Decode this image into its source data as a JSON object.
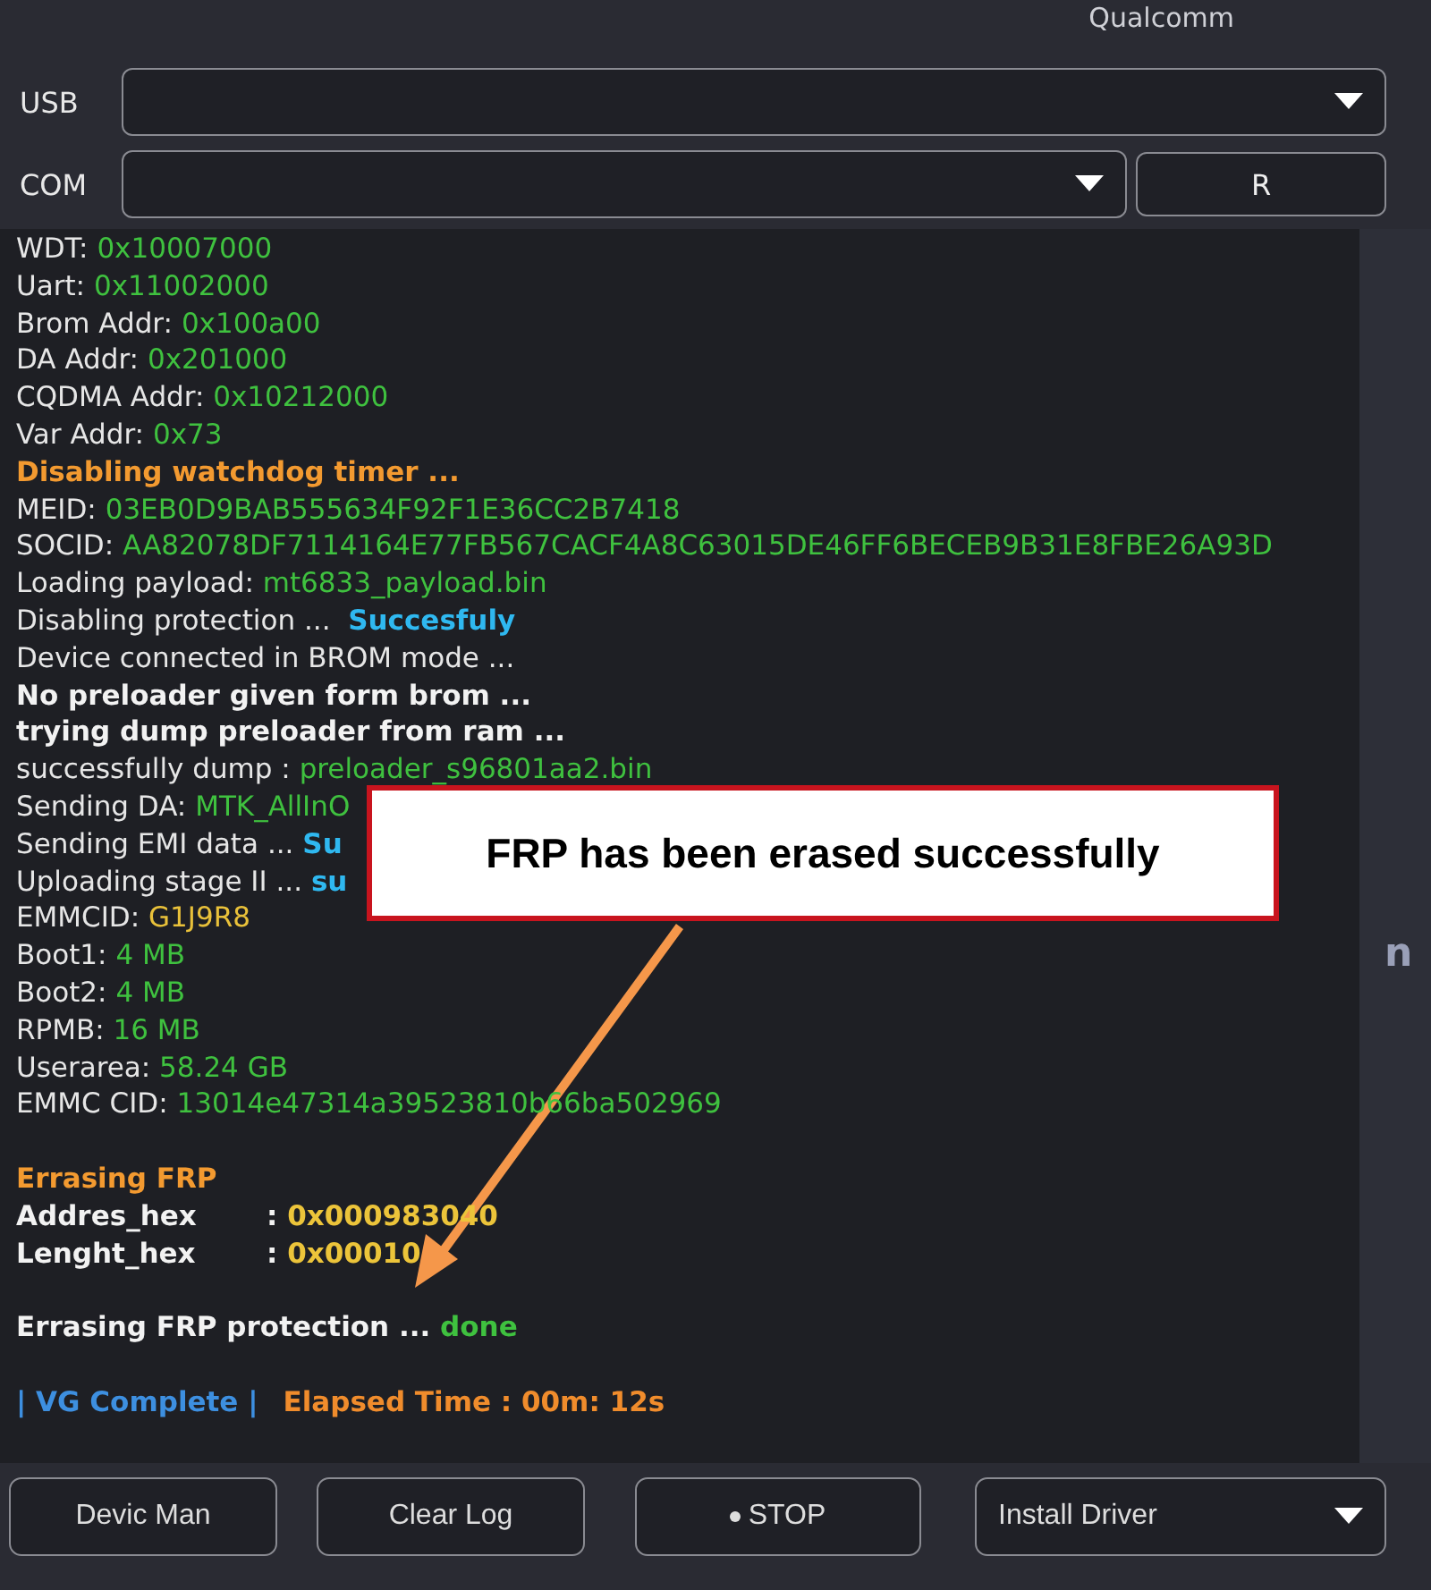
{
  "header": {
    "tab_label": "Qualcomm"
  },
  "usb": {
    "label": "USB"
  },
  "com": {
    "label": "COM",
    "refresh_button": "R"
  },
  "log": [
    {
      "segments": [
        {
          "kind": "text",
          "text": "WDT: "
        },
        {
          "kind": "value",
          "text": "0x10007000"
        }
      ]
    },
    {
      "segments": [
        {
          "kind": "text",
          "text": "Uart: "
        },
        {
          "kind": "value",
          "text": "0x11002000"
        }
      ]
    },
    {
      "segments": [
        {
          "kind": "text",
          "text": "Brom Addr: "
        },
        {
          "kind": "value",
          "text": "0x100a00"
        }
      ]
    },
    {
      "segments": [
        {
          "kind": "text",
          "text": "DA Addr: "
        },
        {
          "kind": "value",
          "text": "0x201000"
        }
      ]
    },
    {
      "segments": [
        {
          "kind": "text",
          "text": "CQDMA Addr: "
        },
        {
          "kind": "value",
          "text": "0x10212000"
        }
      ]
    },
    {
      "segments": [
        {
          "kind": "text",
          "text": "Var Addr: "
        },
        {
          "kind": "value",
          "text": "0x73"
        }
      ]
    },
    {
      "segments": [
        {
          "kind": "heading",
          "text": "Disabling watchdog timer ..."
        }
      ]
    },
    {
      "segments": [
        {
          "kind": "text",
          "text": "MEID: "
        },
        {
          "kind": "value",
          "text": "03EB0D9BAB555634F92F1E36CC2B7418"
        }
      ]
    },
    {
      "segments": [
        {
          "kind": "text",
          "text": "SOCID: "
        },
        {
          "kind": "value",
          "text": "AA82078DF7114164E77FB567CACF4A8C63015DE46FF6BECEB9B31E8FBE26A93D"
        }
      ]
    },
    {
      "segments": [
        {
          "kind": "text",
          "text": "Loading payload: "
        },
        {
          "kind": "value",
          "text": "mt6833_payload.bin"
        }
      ]
    },
    {
      "segments": [
        {
          "kind": "text",
          "text": "Disabling protection ...  "
        },
        {
          "kind": "status",
          "text": "Succesfuly"
        }
      ]
    },
    {
      "segments": [
        {
          "kind": "text",
          "text": "Device connected in BROM mode ..."
        }
      ]
    },
    {
      "segments": [
        {
          "kind": "bold",
          "text": "No preloader given form brom ..."
        }
      ]
    },
    {
      "segments": [
        {
          "kind": "bold",
          "text": "trying dump preloader from ram ..."
        }
      ]
    },
    {
      "segments": [
        {
          "kind": "text",
          "text": "successfully dump : "
        },
        {
          "kind": "value",
          "text": "preloader_s96801aa2.bin"
        }
      ]
    },
    {
      "segments": [
        {
          "kind": "text",
          "text": "Sending DA: "
        },
        {
          "kind": "value",
          "text": "MTK_AllInO"
        }
      ]
    },
    {
      "segments": [
        {
          "kind": "text",
          "text": "Sending EMI data ... "
        },
        {
          "kind": "status",
          "text": "Su"
        }
      ]
    },
    {
      "segments": [
        {
          "kind": "text",
          "text": "Uploading stage II ... "
        },
        {
          "kind": "status",
          "text": "su"
        }
      ]
    },
    {
      "segments": [
        {
          "kind": "text",
          "text": "EMMCID: "
        },
        {
          "kind": "serial",
          "text": "G1J9R8"
        }
      ]
    },
    {
      "segments": [
        {
          "kind": "text",
          "text": "Boot1: "
        },
        {
          "kind": "value",
          "text": "4 MB"
        }
      ]
    },
    {
      "segments": [
        {
          "kind": "text",
          "text": "Boot2: "
        },
        {
          "kind": "value",
          "text": "4 MB"
        }
      ]
    },
    {
      "segments": [
        {
          "kind": "text",
          "text": "RPMB: "
        },
        {
          "kind": "value",
          "text": "16 MB"
        }
      ]
    },
    {
      "segments": [
        {
          "kind": "text",
          "text": "Userarea: "
        },
        {
          "kind": "value",
          "text": "58.24 GB"
        }
      ]
    },
    {
      "segments": [
        {
          "kind": "text",
          "text": "EMMC CID: "
        },
        {
          "kind": "value",
          "text": "13014e47314a39523810b66ba502969"
        }
      ]
    },
    {
      "space_before": true,
      "segments": [
        {
          "kind": "heading",
          "text": "Errasing FRP"
        }
      ]
    },
    {
      "segments": [
        {
          "kind": "field",
          "text": "Addres_hex"
        },
        {
          "kind": "bold",
          "text": ": "
        },
        {
          "kind": "hex",
          "text": "0x000983040"
        }
      ]
    },
    {
      "segments": [
        {
          "kind": "field",
          "text": "Lenght_hex"
        },
        {
          "kind": "bold",
          "text": ": "
        },
        {
          "kind": "hex",
          "text": "0x00010"
        }
      ]
    },
    {
      "space_before": true,
      "segments": [
        {
          "kind": "bold",
          "text": "Errasing FRP protection ... "
        },
        {
          "kind": "done",
          "text": "done"
        }
      ]
    },
    {
      "space_before": true,
      "segments": [
        {
          "kind": "info",
          "text": "| VG Complete |"
        },
        {
          "kind": "timer",
          "text": "Elapsed Time : 00m: 12s"
        }
      ]
    }
  ],
  "side_text": "n",
  "callout": {
    "text": "FRP has been erased successfully"
  },
  "buttons": [
    {
      "kind": "plain",
      "label": "Devic Man"
    },
    {
      "kind": "plain",
      "label": "Clear Log"
    },
    {
      "kind": "dot",
      "label": "STOP"
    },
    {
      "kind": "dropdown",
      "label": "Install Driver"
    }
  ]
}
